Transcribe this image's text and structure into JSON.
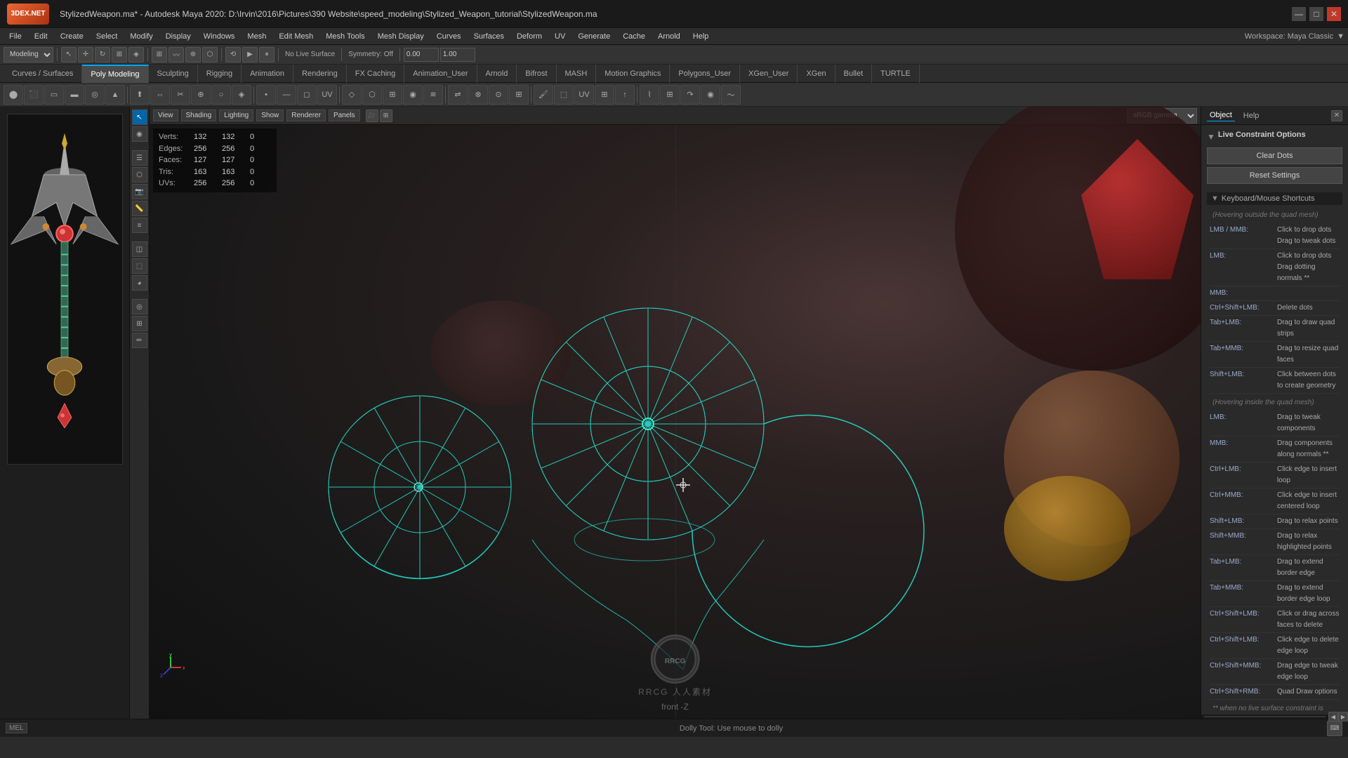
{
  "titleBar": {
    "logo": "3DEX.NET",
    "title": "StylizedWeapon.ma* - Autodesk Maya 2020: D:\\Irvin\\2016\\Pictures\\390 Website\\speed_modeling\\Stylized_Weapon_tutorial\\StylizedWeapon.ma",
    "minimize": "—",
    "maximize": "□",
    "close": "✕"
  },
  "menuBar": {
    "items": [
      "File",
      "Edit",
      "Create",
      "Select",
      "Modify",
      "Display",
      "Windows",
      "Mesh",
      "Edit Mesh",
      "Mesh Tools",
      "Mesh Display",
      "Curves",
      "Surfaces",
      "Deform",
      "UV",
      "Generate",
      "Cache",
      "Arnold",
      "Help"
    ],
    "workspace": "Workspace: Maya Classic"
  },
  "toolbar1": {
    "mode": "Modeling",
    "liveLabel": "No Live Surface",
    "symmetryLabel": "Symmetry: Off"
  },
  "tabs": {
    "items": [
      "Curves / Surfaces",
      "Poly Modeling",
      "Sculpting",
      "Rigging",
      "Animation",
      "Rendering",
      "FX Caching",
      "Animation_User",
      "Arnold",
      "Bifrost",
      "MASH",
      "Motion Graphics",
      "Polygons_User",
      "XGen_User",
      "XGen",
      "Bullet",
      "TURTLE"
    ]
  },
  "viewport": {
    "menus": [
      "View",
      "Shading",
      "Lighting",
      "Show",
      "Renderer",
      "Panels"
    ],
    "colorMode": "sRGB gamma",
    "label": "front -Z",
    "stats": {
      "verts": {
        "label": "Verts:",
        "v1": "132",
        "v2": "132",
        "v3": "0"
      },
      "edges": {
        "label": "Edges:",
        "v1": "256",
        "v2": "256",
        "v3": "0"
      },
      "faces": {
        "label": "Faces:",
        "v1": "127",
        "v2": "127",
        "v3": "0"
      },
      "tris": {
        "label": "Tris:",
        "v1": "163",
        "v2": "163",
        "v3": "0"
      },
      "uvs": {
        "label": "UVs:",
        "v1": "256",
        "v2": "256",
        "v3": "0"
      }
    }
  },
  "rightPanel": {
    "tabs": [
      "Object",
      "Help"
    ],
    "sectionTitle": "Live Constraint Options",
    "clearDotsLabel": "Clear Dots",
    "resetSettingsLabel": "Reset Settings",
    "keyboardSection": "Keyboard/Mouse Shortcuts",
    "note1": "(Hovering outside the quad mesh)",
    "note2": "(Hovering inside the quad mesh)",
    "note3": "** when no live surface constraint is active",
    "shortcuts": [
      {
        "key": "LMB / MMB:",
        "desc": "Click to drop dots\nDrag to tweak dots"
      },
      {
        "key": "LMB:",
        "desc": "Click to drop dots\nDrag dotting normals **"
      },
      {
        "key": "MMB:",
        "desc": ""
      },
      {
        "key": "Ctrl+Shift+LMB:",
        "desc": "Delete dots"
      },
      {
        "key": "Tab+LMB:",
        "desc": "Drag to draw quad strips"
      },
      {
        "key": "Tab+MMB:",
        "desc": "Drag to resize quad faces"
      },
      {
        "key": "Shift+LMB:",
        "desc": "Click between dots to create geometry"
      },
      {
        "key": "LMB:",
        "desc": "Drag to tweak components"
      },
      {
        "key": "MMB:",
        "desc": "Drag components along normals **"
      },
      {
        "key": "Ctrl+LMB:",
        "desc": "Click edge to insert loop"
      },
      {
        "key": "Ctrl+MMB:",
        "desc": "Click edge to insert centered loop"
      },
      {
        "key": "Shift+LMB:",
        "desc": "Drag to relax points"
      },
      {
        "key": "Shift+MMB:",
        "desc": "Drag to relax highlighted points"
      },
      {
        "key": "Tab+LMB:",
        "desc": "Drag to extend border edge"
      },
      {
        "key": "Tab+MMB:",
        "desc": "Drag to extend border edge loop"
      },
      {
        "key": "Ctrl+Shift+LMB:",
        "desc": "Click or drag across faces to delete"
      },
      {
        "key": "Ctrl+Shift+LMB:",
        "desc": "Click edge to delete edge loop"
      },
      {
        "key": "Ctrl+Shift+MMB:",
        "desc": "Drag edge to tweak edge loop"
      },
      {
        "key": "Ctrl+Shift+RMB:",
        "desc": "Quad Draw options"
      }
    ]
  },
  "statusBar": {
    "melLabel": "MEL",
    "statusText": "Dolly Tool: Use mouse to dolly"
  },
  "watermark": {
    "logo": "RR",
    "text": "RRCG 人人素材"
  }
}
